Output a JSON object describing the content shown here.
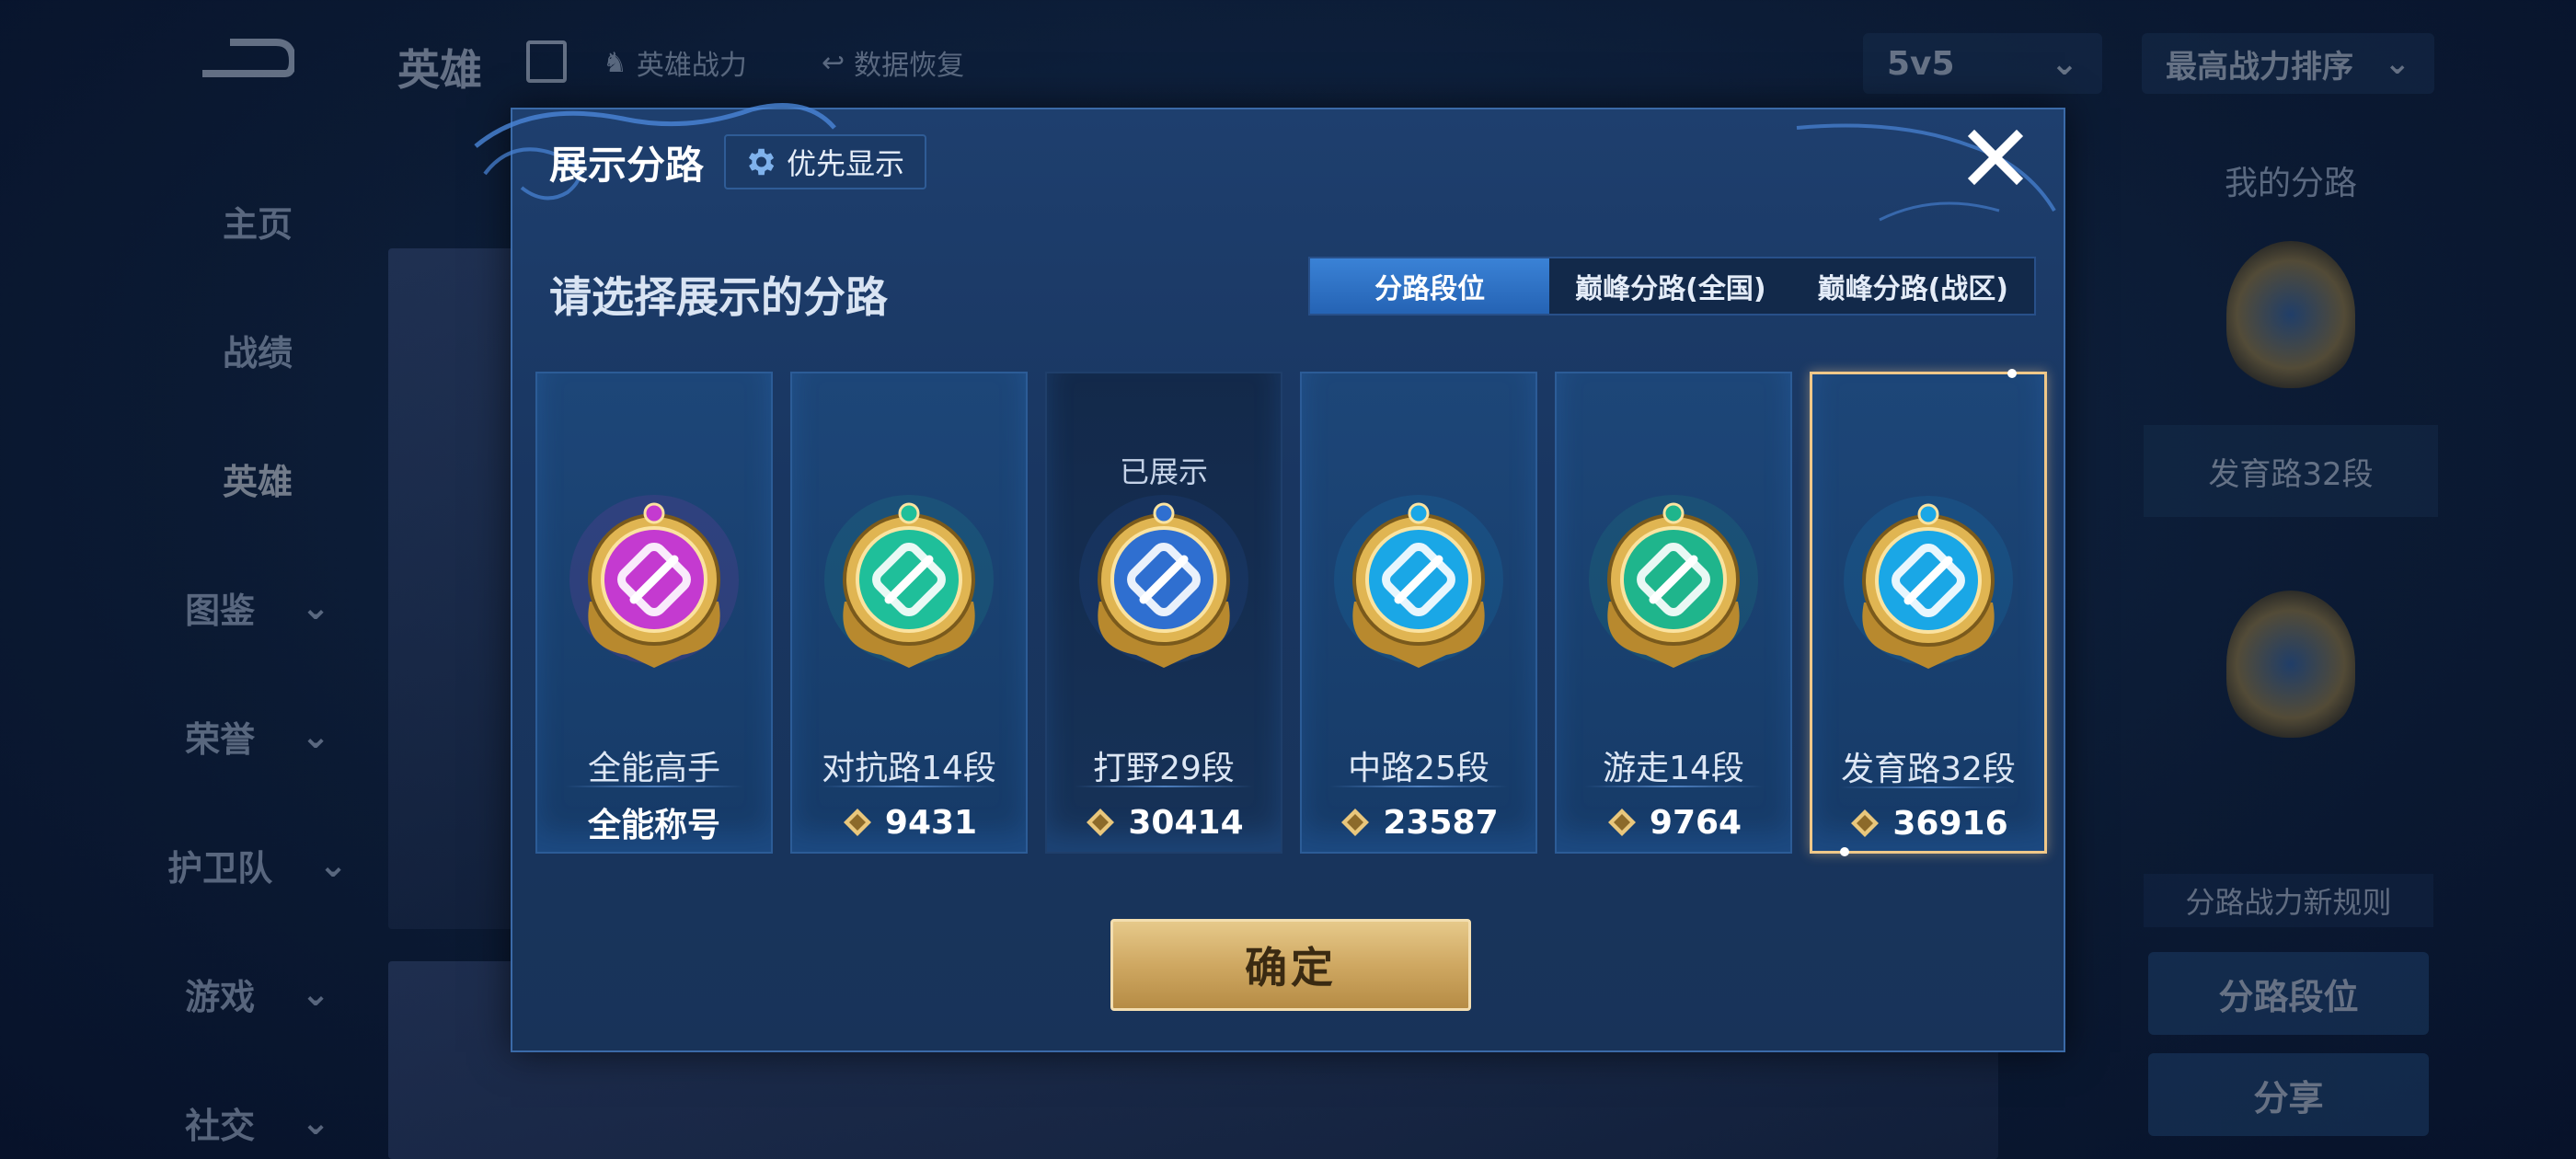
{
  "background": {
    "top_title": "英雄",
    "top_links": [
      "英雄战力",
      "数据恢复"
    ],
    "mode_select": "5v5",
    "sort_select": "最高战力排序",
    "side_menu": [
      {
        "label": "主页",
        "has_arrow": false,
        "active": false
      },
      {
        "label": "战绩",
        "has_arrow": false,
        "active": false
      },
      {
        "label": "英雄",
        "has_arrow": false,
        "active": true
      },
      {
        "label": "图鉴",
        "has_arrow": true,
        "active": false
      },
      {
        "label": "荣誉",
        "has_arrow": true,
        "active": false
      },
      {
        "label": "护卫队",
        "has_arrow": true,
        "active": false
      },
      {
        "label": "游戏",
        "has_arrow": true,
        "active": false
      },
      {
        "label": "社交",
        "has_arrow": true,
        "active": false
      }
    ],
    "right_panel": {
      "title": "我的分路",
      "lane_label": "发育路32段",
      "rule_label": "分路战力新规则",
      "lane_rank_button": "分路段位",
      "share_button": "分享"
    }
  },
  "modal": {
    "title": "展示分路",
    "priority_button": "优先显示",
    "subtitle": "请选择展示的分路",
    "tabs": [
      {
        "label": "分路段位",
        "active": true
      },
      {
        "label": "巅峰分路(全国)",
        "active": false
      },
      {
        "label": "巅峰分路(战区)",
        "active": false
      }
    ],
    "cards": [
      {
        "name": "全能高手",
        "footer": "全能称号",
        "score_icon": false,
        "shown_label": "",
        "emblem": "all-round-emblem-icon",
        "color": "#c43ad0",
        "state": "normal"
      },
      {
        "name": "对抗路14段",
        "footer": "9431",
        "score_icon": true,
        "shown_label": "",
        "emblem": "clash-lane-emblem-icon",
        "color": "#1fbf9a",
        "state": "normal"
      },
      {
        "name": "打野29段",
        "footer": "30414",
        "score_icon": true,
        "shown_label": "已展示",
        "emblem": "jungle-dragon-emblem-icon",
        "color": "#2f6fd0",
        "state": "shown"
      },
      {
        "name": "中路25段",
        "footer": "23587",
        "score_icon": true,
        "shown_label": "",
        "emblem": "mid-lane-emblem-icon",
        "color": "#1aa7e6",
        "state": "normal"
      },
      {
        "name": "游走14段",
        "footer": "9764",
        "score_icon": true,
        "shown_label": "",
        "emblem": "roam-wings-emblem-icon",
        "color": "#1fb58c",
        "state": "normal"
      },
      {
        "name": "发育路32段",
        "footer": "36916",
        "score_icon": true,
        "shown_label": "",
        "emblem": "farm-lane-emblem-icon",
        "color": "#1aa7e6",
        "state": "selected"
      }
    ],
    "confirm_button": "确定"
  }
}
